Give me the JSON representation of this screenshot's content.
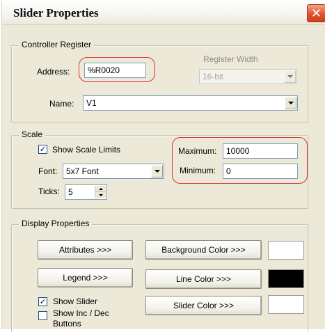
{
  "window": {
    "title": "Slider Properties",
    "close_glyph": "✕"
  },
  "controller_register": {
    "legend": "Controller Register",
    "address_label": "Address:",
    "address_value": "%R0020",
    "register_width_label": "Register Width",
    "register_width_value": "16-bit",
    "name_label": "Name:",
    "name_value": "V1"
  },
  "scale": {
    "legend": "Scale",
    "show_scale_limits_label": "Show Scale Limits",
    "show_scale_limits_checked": true,
    "font_label": "Font:",
    "font_value": "5x7 Font",
    "ticks_label": "Ticks:",
    "ticks_value": "5",
    "maximum_label": "Maximum:",
    "maximum_value": "10000",
    "minimum_label": "Minimum:",
    "minimum_value": "0"
  },
  "display_properties": {
    "legend": "Display Properties",
    "attributes_button": "Attributes >>>",
    "legend_button": "Legend >>>",
    "background_color_button": "Background Color >>>",
    "line_color_button": "Line Color >>>",
    "slider_color_button": "Slider Color >>>",
    "background_color": "#ffffff",
    "line_color": "#000000",
    "slider_color": "#ffffff",
    "show_slider_label": "Show Slider",
    "show_slider_checked": true,
    "show_inc_dec_label_line1": "Show Inc / Dec",
    "show_inc_dec_label_line2": "Buttons",
    "show_inc_dec_checked": false
  },
  "colors": {
    "highlight_ring": "#d9332c",
    "dialog_bg": "#ece9d8"
  }
}
